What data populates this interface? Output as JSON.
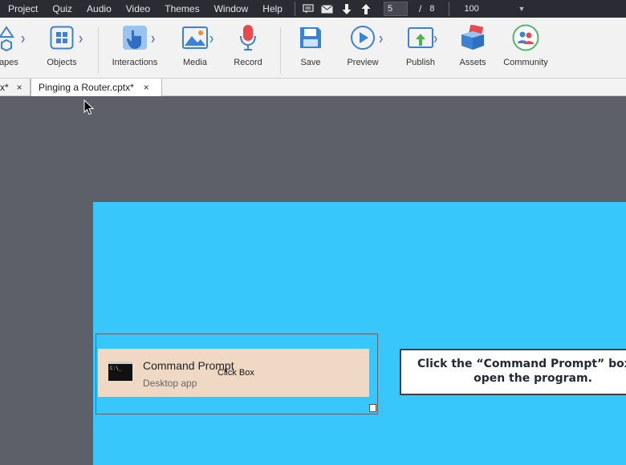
{
  "menubar": {
    "items": [
      "Project",
      "Quiz",
      "Audio",
      "Video",
      "Themes",
      "Window",
      "Help"
    ],
    "icons": [
      "slide-notes-icon",
      "mail-icon",
      "arrow-down-icon",
      "arrow-up-icon"
    ],
    "slide_current": "5",
    "slide_separator": "/",
    "slide_total": "8",
    "zoom": "100"
  },
  "toolbar": {
    "shapes_label": "apes",
    "objects_label": "Objects",
    "interactions_label": "Interactions",
    "media_label": "Media",
    "record_label": "Record",
    "save_label": "Save",
    "preview_label": "Preview",
    "publish_label": "Publish",
    "assets_label": "Assets",
    "community_label": "Community"
  },
  "tabs": [
    {
      "label": "x*",
      "close": "×"
    },
    {
      "label": "Pinging a Router.cptx*",
      "close": "×"
    }
  ],
  "slide": {
    "result_title": "Command Prompt",
    "result_subtitle": "Desktop app",
    "cmd_icon_text": "C:\\_",
    "clickbox_label": "Click Box",
    "caption": "Click the “Command Prompt” box to open the program."
  },
  "colors": {
    "menubar_bg": "#2b2c33",
    "toolbar_bg": "#f2f2f2",
    "workspace_bg": "#5e6069",
    "slide_bg": "#37c7fa",
    "card_bg": "#f0d9c4",
    "accent_blue": "#3a82d6"
  }
}
